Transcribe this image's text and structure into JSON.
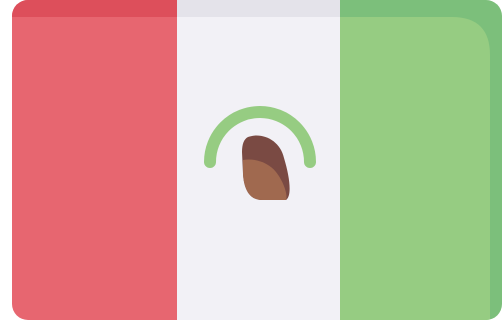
{
  "icon": {
    "name": "mexico-flag-icon",
    "colors": {
      "red_band": "#E76670",
      "red_band_top": "#DD4F5B",
      "white_band": "#F2F1F6",
      "white_band_top": "#E4E3EA",
      "green_band": "#96CC82",
      "green_band_shade": "#7CBF7B",
      "laurel_arc": "#96CC82",
      "emblem_light": "#A0694F",
      "emblem_dark": "#7A4A43"
    }
  }
}
